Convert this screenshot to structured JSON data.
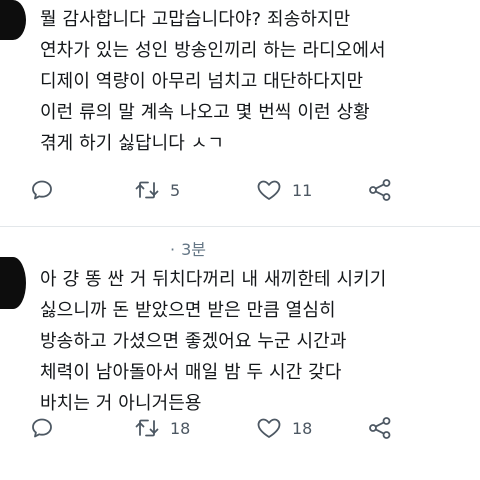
{
  "tweets": [
    {
      "lines": [
        "뭘 감사합니다 고맙습니다야? 죄송하지만",
        "연차가 있는 성인 방송인끼리 하는 라디오에서",
        "디제이 역량이 아무리 넘치고 대단하다지만",
        "이런 류의 말 계속 나오고 몇 번씩 이런 상황",
        "겪게 하기 싫답니다 ㅅㄱ"
      ],
      "retweets": "5",
      "likes": "11"
    },
    {
      "timestamp": "3분",
      "lines": [
        "아 걍 똥 싼 거 뒤치다꺼리 내 새끼한테 시키기",
        "싫으니까 돈 받았으면 받은 만큼 열심히",
        "방송하고 가셨으면 좋겠어요 누군 시간과",
        "체력이 남아돌아서 매일 밤 두 시간 갖다",
        "바치는 거 아니거든용"
      ],
      "retweets": "18",
      "likes": "18"
    }
  ],
  "icons": {
    "reply": "reply-icon",
    "retweet": "retweet-icon",
    "like": "like-icon",
    "share": "share-icon"
  },
  "colors": {
    "icon": "#4d5863",
    "text": "#14171a",
    "meta": "#657786"
  }
}
